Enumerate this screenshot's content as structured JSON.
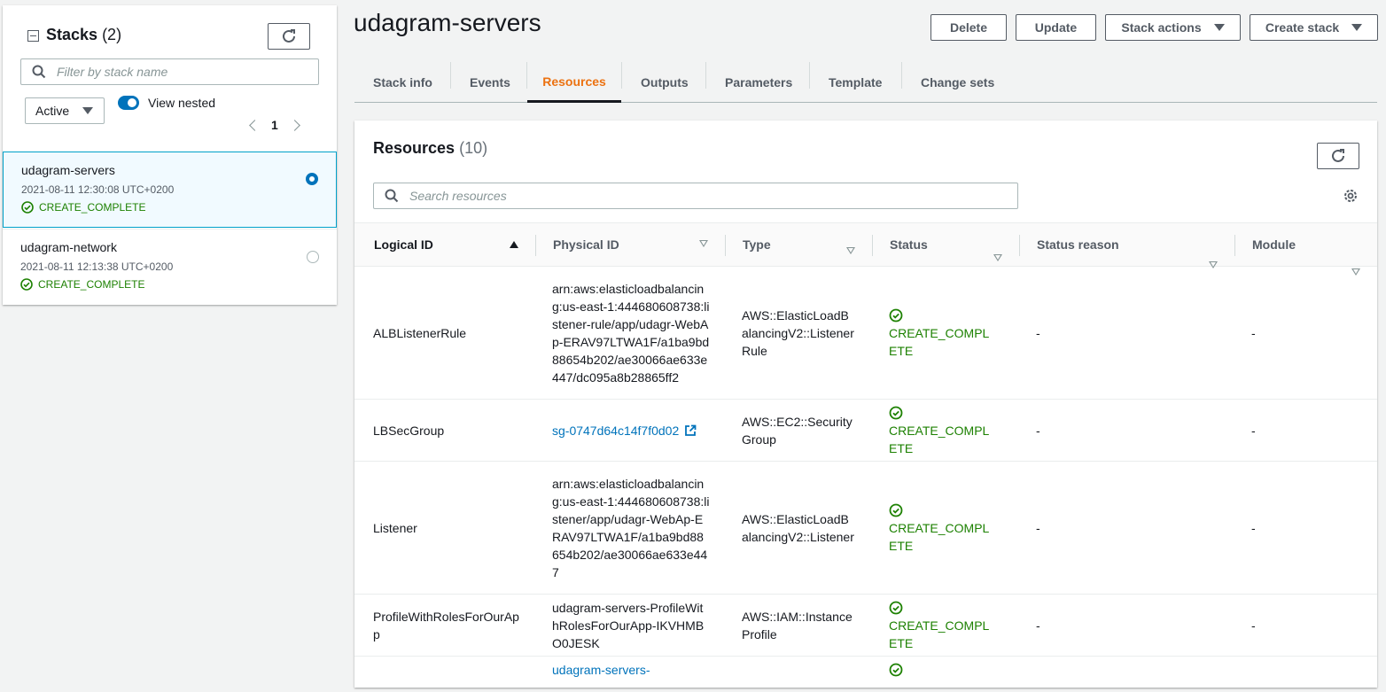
{
  "stacks_panel": {
    "title": "Stacks",
    "count": "(2)",
    "search_placeholder": "Filter by stack name",
    "filter_value": "Active",
    "toggle_label": "View nested",
    "page": "1",
    "stacks": [
      {
        "name": "udagram-servers",
        "date": "2021-08-11 12:30:08 UTC+0200",
        "status": "CREATE_COMPLETE",
        "selected": true
      },
      {
        "name": "udagram-network",
        "date": "2021-08-11 12:13:38 UTC+0200",
        "status": "CREATE_COMPLETE",
        "selected": false
      }
    ]
  },
  "header": {
    "title": "udagram-servers",
    "buttons": {
      "delete": "Delete",
      "update": "Update",
      "stack_actions": "Stack actions",
      "create_stack": "Create stack"
    }
  },
  "tabs": [
    "Stack info",
    "Events",
    "Resources",
    "Outputs",
    "Parameters",
    "Template",
    "Change sets"
  ],
  "active_tab": "Resources",
  "resources": {
    "title": "Resources",
    "count": "(10)",
    "search_placeholder": "Search resources",
    "columns": {
      "logical_id": "Logical ID",
      "physical_id": "Physical ID",
      "type": "Type",
      "status": "Status",
      "status_reason": "Status reason",
      "module": "Module"
    },
    "rows": [
      {
        "logical_id": "ALBListenerRule",
        "physical_id": "arn:aws:elasticloadbalancing:us-east-1:444680608738:listener-rule/app/udagr-WebAp-ERAV97LTWA1F/a1ba9bd88654b202/ae30066ae633e447/dc095a8b28865ff2",
        "type": "AWS::ElasticLoadBalancingV2::ListenerRule",
        "status": "CREATE_COMPLETE",
        "status_reason": "-",
        "module": "-"
      },
      {
        "logical_id": "LBSecGroup",
        "physical_id": "sg-0747d64c14f7f0d02",
        "type": "AWS::EC2::SecurityGroup",
        "status": "CREATE_COMPLETE",
        "status_reason": "-",
        "module": "-"
      },
      {
        "logical_id": "Listener",
        "physical_id": "arn:aws:elasticloadbalancing:us-east-1:444680608738:listener/app/udagr-WebAp-ERAV97LTWA1F/a1ba9bd88654b202/ae30066ae633e447",
        "type": "AWS::ElasticLoadBalancingV2::Listener",
        "status": "CREATE_COMPLETE",
        "status_reason": "-",
        "module": "-"
      },
      {
        "logical_id": "ProfileWithRolesForOurApp",
        "physical_id": "udagram-servers-ProfileWithRolesForOurApp-IKVHMBO0JESK",
        "type": "AWS::IAM::InstanceProfile",
        "status": "CREATE_COMPLETE",
        "status_reason": "-",
        "module": "-"
      },
      {
        "logical_id": "",
        "physical_id": "udagram-servers-",
        "type": "",
        "status": "",
        "status_reason": "",
        "module": ""
      }
    ]
  },
  "colors": {
    "accent": "#ec7211",
    "link": "#0073bb",
    "success": "#1d8102",
    "selected_bg": "#f1faff"
  }
}
